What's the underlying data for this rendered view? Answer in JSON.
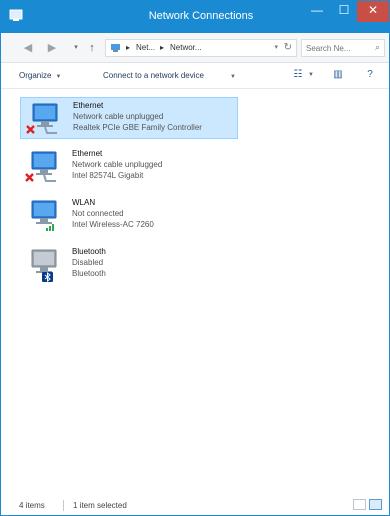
{
  "window": {
    "title": "Network Connections",
    "controls": {
      "minimize": "—",
      "maximize": "☐",
      "close": "✕"
    }
  },
  "address": {
    "breadcrumb": [
      "Net...",
      "Networ..."
    ],
    "search_placeholder": "Search Ne..."
  },
  "toolbar": {
    "organize": "Organize",
    "connect": "Connect to a network device"
  },
  "connections": [
    {
      "name": "Ethernet",
      "status": "Network cable unplugged",
      "device": "Realtek PCIe GBE Family Controller",
      "state": "disconnected",
      "selected": true
    },
    {
      "name": "Ethernet",
      "status": "Network cable unplugged",
      "device": "Intel 82574L Gigabit",
      "state": "disconnected",
      "selected": false
    },
    {
      "name": "WLAN",
      "status": "Not connected",
      "device": "Intel Wireless-AC 7260",
      "state": "wifi",
      "selected": false
    },
    {
      "name": "Bluetooth",
      "status": "Disabled",
      "device": "Bluetooth",
      "state": "bluetooth",
      "selected": false
    }
  ],
  "status": {
    "items_count": "4 items",
    "selected": "1 item selected"
  },
  "colors": {
    "accent": "#1a8ad2",
    "selection": "#cce8ff",
    "close": "#c94f46"
  }
}
